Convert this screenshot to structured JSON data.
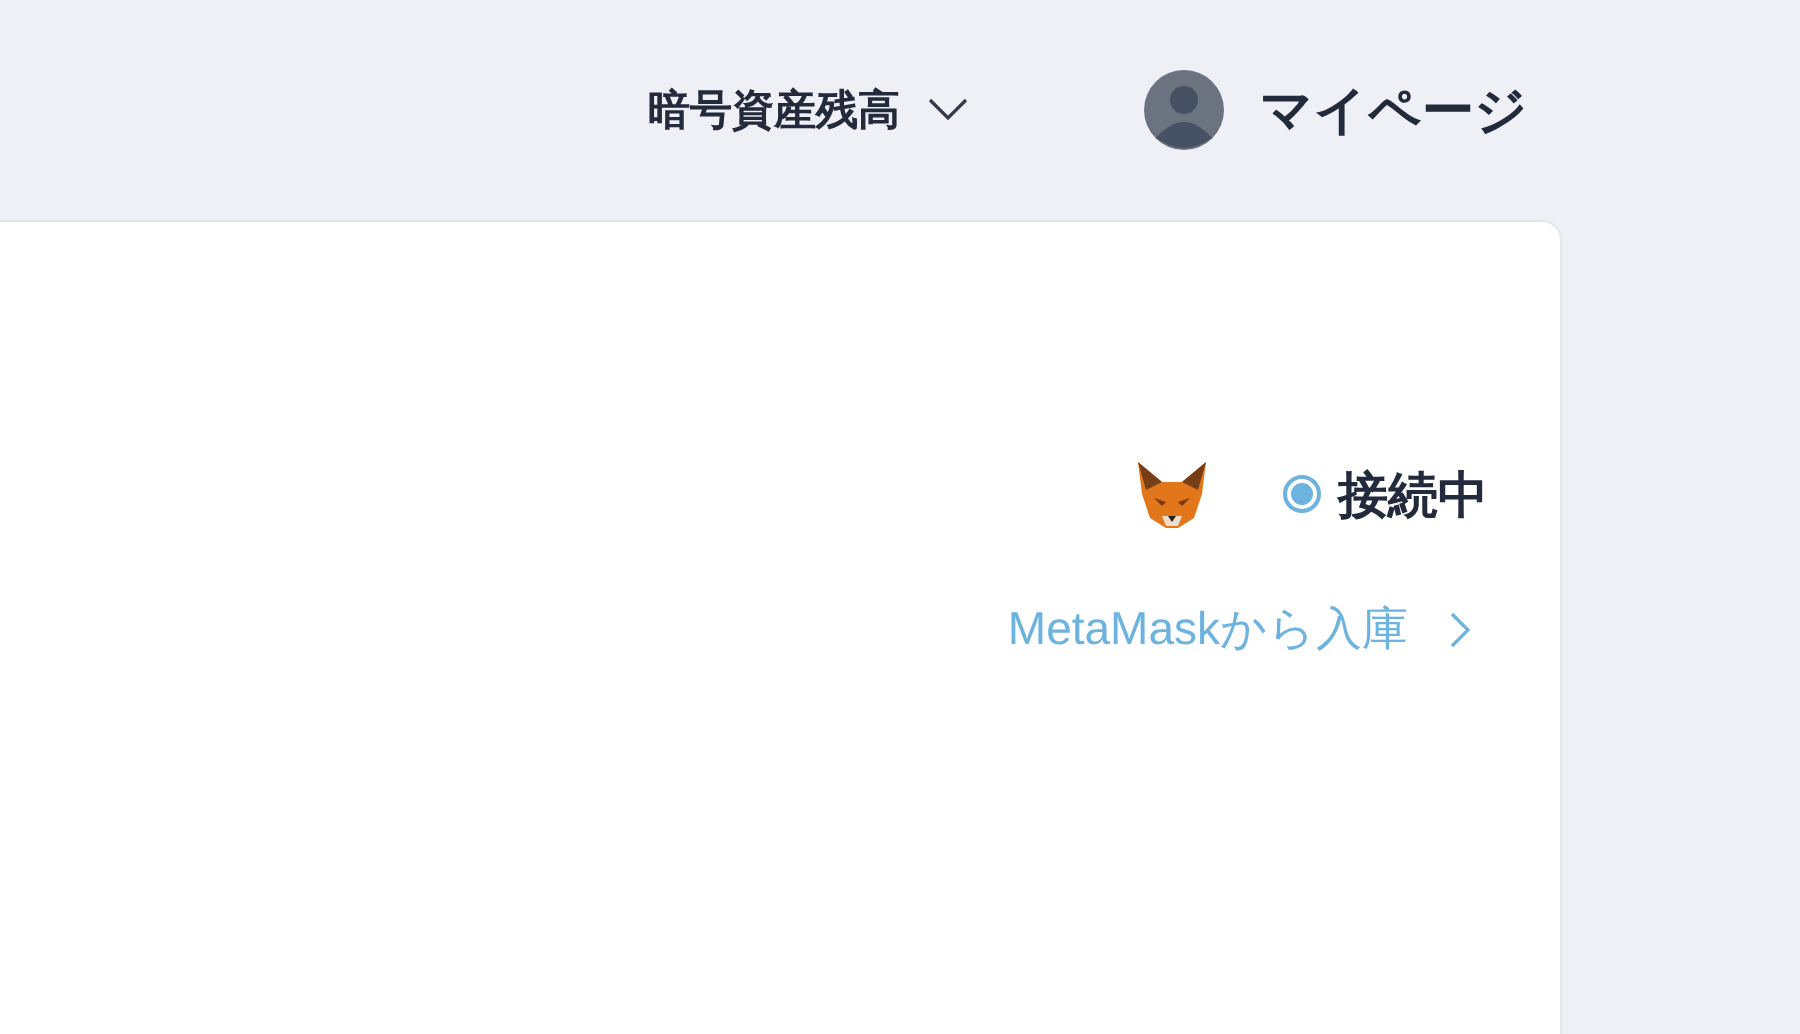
{
  "header": {
    "menu": {
      "label": "暗号資産残高",
      "expanded": false
    },
    "account": {
      "label": "マイページ"
    }
  },
  "wallet": {
    "status": {
      "label": "接続中",
      "connected": true
    },
    "deposit_link": {
      "label": "MetaMaskから入庫"
    }
  }
}
